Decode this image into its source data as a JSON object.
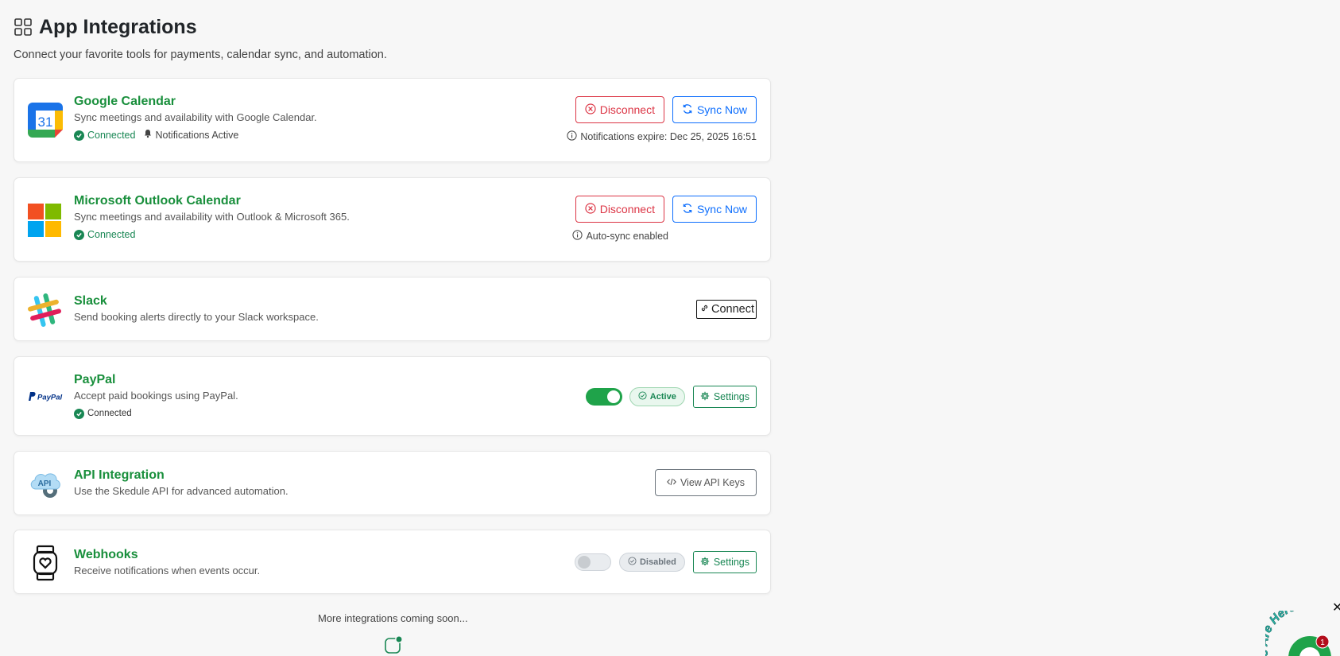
{
  "page": {
    "title": "App Integrations",
    "subtitle": "Connect your favorite tools for payments, calendar sync, and automation.",
    "footer_note": "More integrations coming soon..."
  },
  "integrations": [
    {
      "name": "Google Calendar",
      "description": "Sync meetings and availability with Google Calendar.",
      "status": "Connected",
      "notifications": "Notifications Active",
      "disconnect_label": "Disconnect",
      "sync_label": "Sync Now",
      "note": "Notifications expire: Dec 25, 2025 16:51",
      "logo_text": "31"
    },
    {
      "name": "Microsoft Outlook Calendar",
      "description": "Sync meetings and availability with Outlook & Microsoft 365.",
      "status": "Connected",
      "disconnect_label": "Disconnect",
      "sync_label": "Sync Now",
      "note": "Auto-sync enabled"
    },
    {
      "name": "Slack",
      "description": "Send booking alerts directly to your Slack workspace.",
      "connect_label": "Connect"
    },
    {
      "name": "PayPal",
      "description": "Accept paid bookings using PayPal.",
      "status": "Connected",
      "toggle_on": true,
      "badge": "Active",
      "settings_label": "Settings",
      "logo_text": "PayPal"
    },
    {
      "name": "API Integration",
      "description": "Use the Skedule API for advanced automation.",
      "view_keys_label": "View API Keys",
      "logo_text": "API"
    },
    {
      "name": "Webhooks",
      "description": "Receive notifications when events occur.",
      "toggle_on": false,
      "badge": "Disabled",
      "settings_label": "Settings"
    }
  ],
  "widget": {
    "text": "We Are Here",
    "badge_count": "1",
    "close_symbol": "✕"
  },
  "colors": {
    "accent_green": "#198f3c",
    "success": "#198754",
    "danger": "#dc3545",
    "primary": "#0d6efd",
    "background": "#f7f7f7"
  },
  "icons": [
    "grid-icon",
    "check-circle-icon",
    "bell-icon",
    "x-circle-icon",
    "refresh-icon",
    "info-icon",
    "link-icon",
    "gear-icon",
    "code-icon"
  ]
}
